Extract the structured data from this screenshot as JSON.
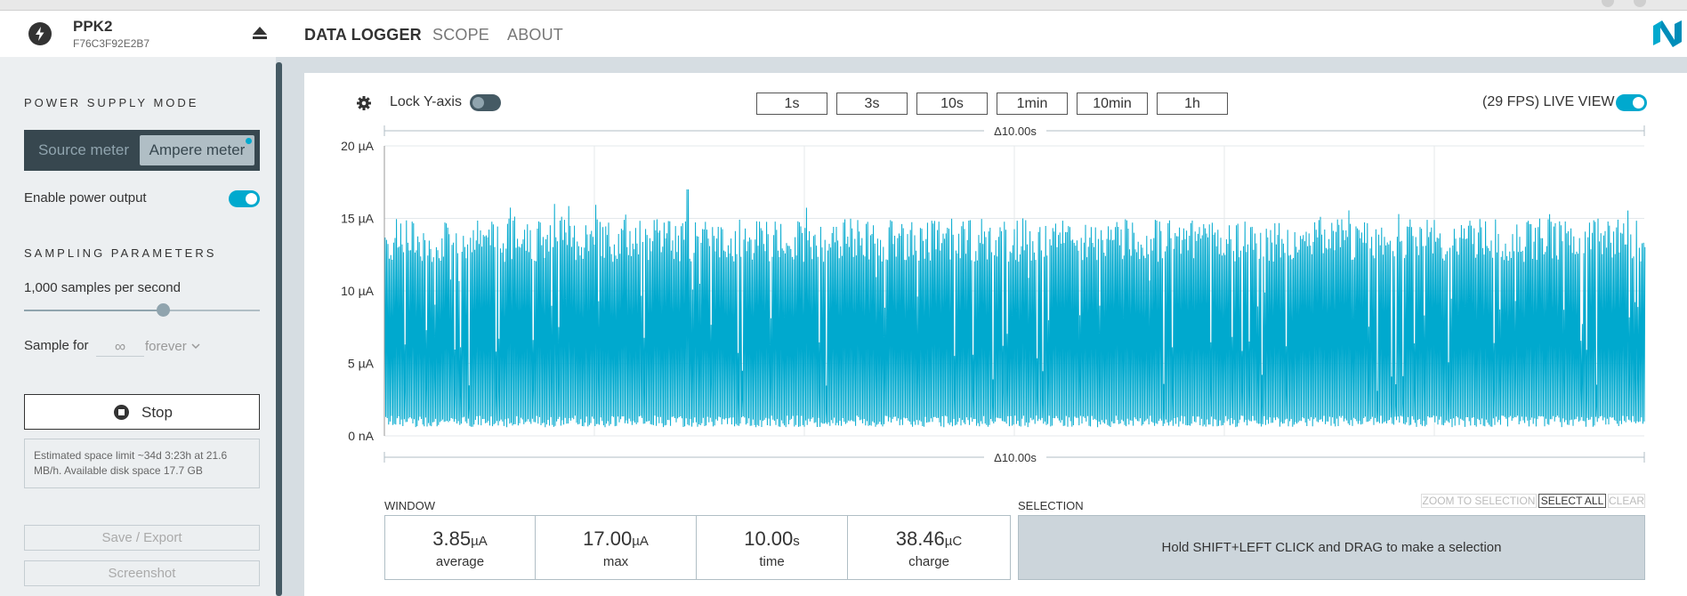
{
  "navbar": {
    "device_name": "PPK2",
    "device_serial": "F76C3F92E2B7",
    "tabs": [
      {
        "label": "DATA LOGGER",
        "active": true
      },
      {
        "label": "SCOPE",
        "active": false
      },
      {
        "label": "ABOUT",
        "active": false
      }
    ],
    "icons": {
      "device": "bolt-icon",
      "eject": "eject-icon",
      "logo": "nordic-logo"
    }
  },
  "sidebar": {
    "power_supply_heading": "POWER SUPPLY MODE",
    "modes": [
      {
        "label": "Source meter",
        "selected": false
      },
      {
        "label": "Ampere meter",
        "selected": true
      }
    ],
    "enable_power_label": "Enable power output",
    "enable_power_on": true,
    "sampling_heading": "SAMPLING PARAMETERS",
    "sample_rate_label": "1,000 samples per second",
    "sample_rate_slider_fraction": 0.59,
    "sample_for_label": "Sample for",
    "sample_for_value": "∞",
    "sample_for_unit": "forever",
    "stop_label": "Stop",
    "space_info": "Estimated space limit ~34d 3:23h at 21.6 MB/h. Available disk space 17.7 GB",
    "save_export_label": "Save / Export",
    "screenshot_label": "Screenshot"
  },
  "toolbar": {
    "lock_y_label": "Lock Y-axis",
    "lock_y_on": false,
    "windows": [
      "1s",
      "3s",
      "10s",
      "1min",
      "10min",
      "1h"
    ],
    "live_view_label": "(29 FPS) LIVE VIEW",
    "live_view_on": true
  },
  "chart_data": {
    "type": "line",
    "y_ticks": [
      "20 µA",
      "15 µA",
      "10 µA",
      "5 µA",
      "0 nA"
    ],
    "ylim": [
      0,
      20
    ],
    "top_span_label": "Δ10.00s",
    "bottom_span_label": "Δ10.00s",
    "series_color": "#00a9ce",
    "duration_s": 10,
    "baseline_ua": 0.6,
    "typical_peak_ua": [
      12,
      15
    ],
    "max_ua": 17.0,
    "average_ua": 3.85
  },
  "stats": {
    "window_label": "WINDOW",
    "items": [
      {
        "value": "3.85",
        "unit": "µA",
        "name": "average"
      },
      {
        "value": "17.00",
        "unit": "µA",
        "name": "max"
      },
      {
        "value": "10.00",
        "unit": "s",
        "name": "time"
      },
      {
        "value": "38.46",
        "unit": "µC",
        "name": "charge"
      }
    ]
  },
  "selection": {
    "label": "SELECTION",
    "zoom_label": "ZOOM TO SELECTION",
    "select_all_label": "SELECT ALL",
    "clear_label": "CLEAR",
    "hint": "Hold SHIFT+LEFT CLICK and DRAG to make a selection"
  },
  "colors": {
    "accent": "#00a9ce",
    "dark": "#37474f",
    "sidebar_bg": "#eceff1"
  }
}
